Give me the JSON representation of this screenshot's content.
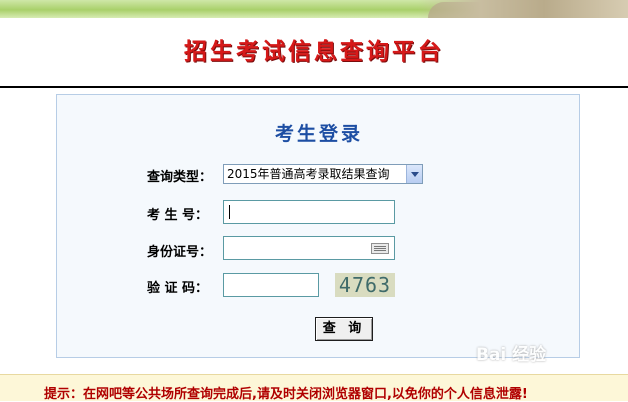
{
  "header": {
    "title": "招生考试信息查询平台"
  },
  "login": {
    "title": "考生登录",
    "query_type": {
      "label": "查询类型：",
      "selected": "2015年普通高考录取结果查询"
    },
    "exam_number": {
      "label": "考 生 号：",
      "value": ""
    },
    "id_number": {
      "label": "身份证号：",
      "value": ""
    },
    "captcha": {
      "label": "验 证 码：",
      "value": "",
      "code": "4763"
    },
    "submit_label": "查 询"
  },
  "notice": {
    "text": "提示：在网吧等公共场所查询完成后,请及时关闭浏览器窗口,以免你的个人信息泄露!"
  },
  "watermark": {
    "text": "Bai 经验"
  },
  "colors": {
    "title_red": "#d61919",
    "login_blue": "#1d4ea3",
    "notice_red": "#b00000",
    "panel_bg": "#f5f9fd"
  },
  "icons": {
    "select_arrow": "chevron-down-icon",
    "keyboard": "keyboard-icon"
  }
}
